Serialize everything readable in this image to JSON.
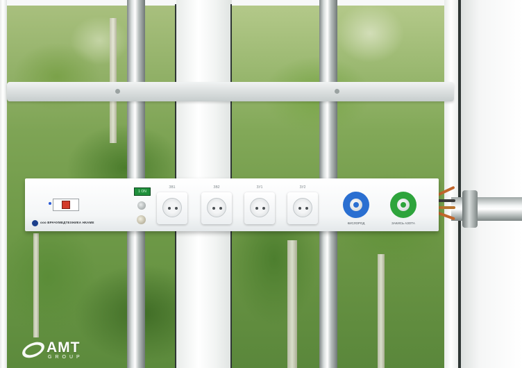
{
  "panel": {
    "brand_text": "ооо ВРАЧУМЕДТЕХНИКА  НКАМЕ",
    "indicator_text": "1 ON",
    "sockets": [
      {
        "label": "ЗВ1"
      },
      {
        "label": "ЗВ2"
      },
      {
        "label": "ЗУ1"
      },
      {
        "label": "ЗУ2"
      }
    ],
    "gas_outlets": [
      {
        "label": "КИСЛОРОД",
        "color": "#2a6fd1"
      },
      {
        "label": "ЗАКИСЬ АЗОТА",
        "color": "#2ea43c"
      }
    ]
  },
  "logo": {
    "name": "AMT",
    "subtitle": "GROUP"
  },
  "colors": {
    "foliage": "#6f9a48",
    "frame": "#f4f6f5",
    "breaker_red": "#d33a2a",
    "indicator_green": "#1f8f3b"
  }
}
